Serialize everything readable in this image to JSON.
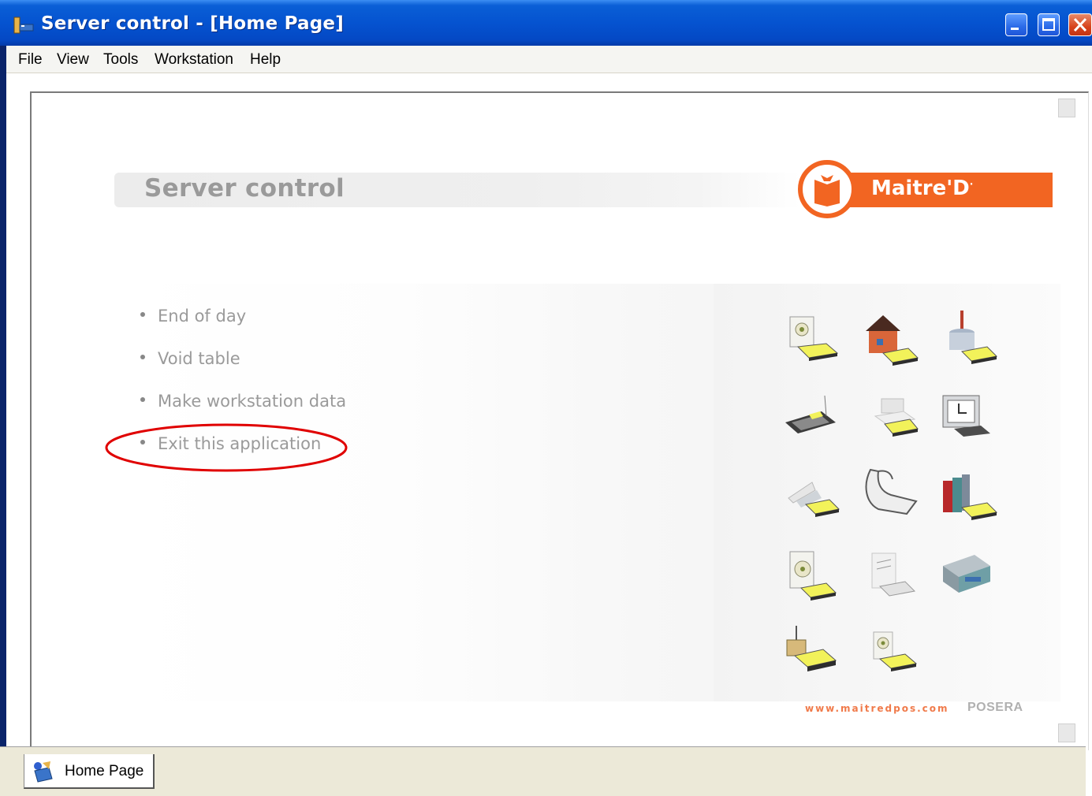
{
  "window": {
    "title": "Server control - [Home Page]"
  },
  "menu": {
    "items": [
      "File",
      "View",
      "Tools",
      "Workstation",
      "Help"
    ]
  },
  "page": {
    "heading": "Server control",
    "brand": "Maitre'D",
    "brand_mark": "·",
    "links": [
      {
        "label": "End of day"
      },
      {
        "label": "Void table"
      },
      {
        "label": "Make workstation data"
      },
      {
        "label": "Exit this application"
      }
    ],
    "footer_url": "www.maitredpos.com",
    "footer_brand": "POSERA",
    "icons": [
      "cd-drive-icon",
      "house-icon",
      "database-icon",
      "keyboard-icon",
      "printer-icon",
      "monitor-clock-icon",
      "paper-feed-icon",
      "paper-roll-icon",
      "books-icon",
      "disk-cd-icon",
      "document-stack-icon",
      "server-icon",
      "antenna-icon",
      "cd-small-icon"
    ],
    "highlight_color": "#e00000",
    "accent_color": "#f26522"
  },
  "tabs": {
    "active": "Home Page"
  }
}
